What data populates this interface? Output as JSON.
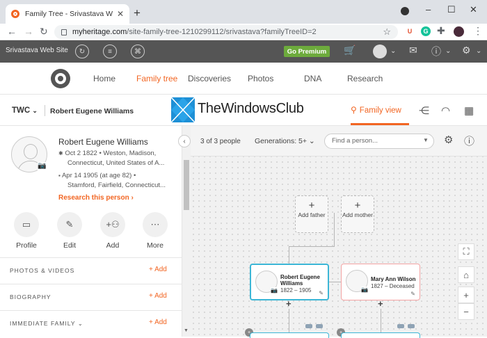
{
  "browser": {
    "tab_title": "Family Tree - Srivastava Web Site",
    "tab_close": "✕",
    "new_tab": "+",
    "url_host": "myheritage.com",
    "url_path": "/site-family-tree-1210299112/srivastava?familyTreeID=2",
    "window_controls": [
      "–",
      "☐",
      "✕"
    ],
    "extensions": [
      {
        "icon": "ublock-icon",
        "label": "U",
        "color": "#e34f2f"
      },
      {
        "icon": "grammarly-icon",
        "label": "G",
        "color": "#15c39a"
      }
    ]
  },
  "site": {
    "name": "Srivastava Web Site",
    "go_premium": "Go Premium",
    "nav": [
      "Home",
      "Family tree",
      "Discoveries",
      "Photos",
      "DNA",
      "Research"
    ],
    "active_nav": "Family tree"
  },
  "subheader": {
    "tree_code": "TWC",
    "person_name": "Robert Eugene Williams",
    "watermark": "TheWindowsClub",
    "family_view": "Family view"
  },
  "profile": {
    "name": "Robert Eugene Williams",
    "birth_line1": "Oct 2 1822 • Weston, Madison,",
    "birth_line2": "Connecticut, United States of A...",
    "death_line1": "Apr 14 1905 (at age 82) •",
    "death_line2": "Stamford, Fairfield, Connecticut...",
    "research_link": "Research this person ›",
    "actions": [
      {
        "label": "Profile",
        "icon": "profile-card-icon"
      },
      {
        "label": "Edit",
        "icon": "pencil-icon"
      },
      {
        "label": "Add",
        "icon": "add-person-icon"
      },
      {
        "label": "More",
        "icon": "more-dots-icon"
      }
    ],
    "sections": [
      {
        "title": "PHOTOS & VIDEOS",
        "add": "+ Add"
      },
      {
        "title": "BIOGRAPHY",
        "add": "+ Add"
      },
      {
        "title": "IMMEDIATE FAMILY ⌄",
        "add": "+ Add"
      }
    ]
  },
  "tree": {
    "people_count": "3 of 3 people",
    "generations": "Generations: 5+ ⌄",
    "find_placeholder": "Find a person...",
    "add_father": "Add father",
    "add_mother": "Add mother",
    "person1": {
      "name_line1": "Robert Eugene",
      "name_line2": "Williams",
      "dates": "1822 – 1905",
      "border": "#3cb6d6"
    },
    "person2": {
      "name": "Mary Ann Wilson",
      "dates": "1827 – Deceased",
      "border": "#f4a3a3"
    }
  }
}
